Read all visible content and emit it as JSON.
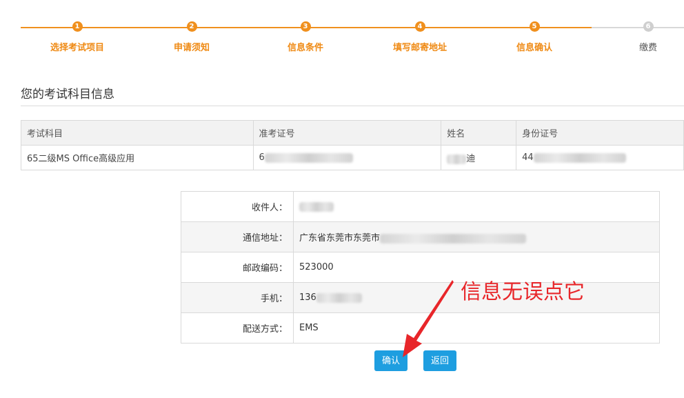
{
  "steps": [
    {
      "num": "1",
      "label": "选择考试项目",
      "state": "done"
    },
    {
      "num": "2",
      "label": "申请须知",
      "state": "done"
    },
    {
      "num": "3",
      "label": "信息条件",
      "state": "done"
    },
    {
      "num": "4",
      "label": "填写邮寄地址",
      "state": "done"
    },
    {
      "num": "5",
      "label": "信息确认",
      "state": "done"
    },
    {
      "num": "6",
      "label": "缴费",
      "state": "todo"
    }
  ],
  "section_title": "您的考试科目信息",
  "subjects": {
    "headers": [
      "考试科目",
      "准考证号",
      "姓名",
      "身份证号"
    ],
    "row": {
      "subject": "65二级MS Office高级应用",
      "ticket_prefix": "6",
      "name_suffix": "迪",
      "id_prefix": "44"
    }
  },
  "info": {
    "recipient_label": "收件人：",
    "recipient_value": "",
    "address_label": "通信地址：",
    "address_value": "广东省东莞市东莞市",
    "zip_label": "邮政编码：",
    "zip_value": "523000",
    "phone_label": "手机：",
    "phone_value": "136",
    "delivery_label": "配送方式：",
    "delivery_value": "EMS"
  },
  "buttons": {
    "confirm": "确认",
    "back": "返回"
  },
  "annotation": "信息无误点它",
  "colors": {
    "accent": "#f0901e",
    "button": "#1e9ee0",
    "annotation": "#e8262a"
  }
}
